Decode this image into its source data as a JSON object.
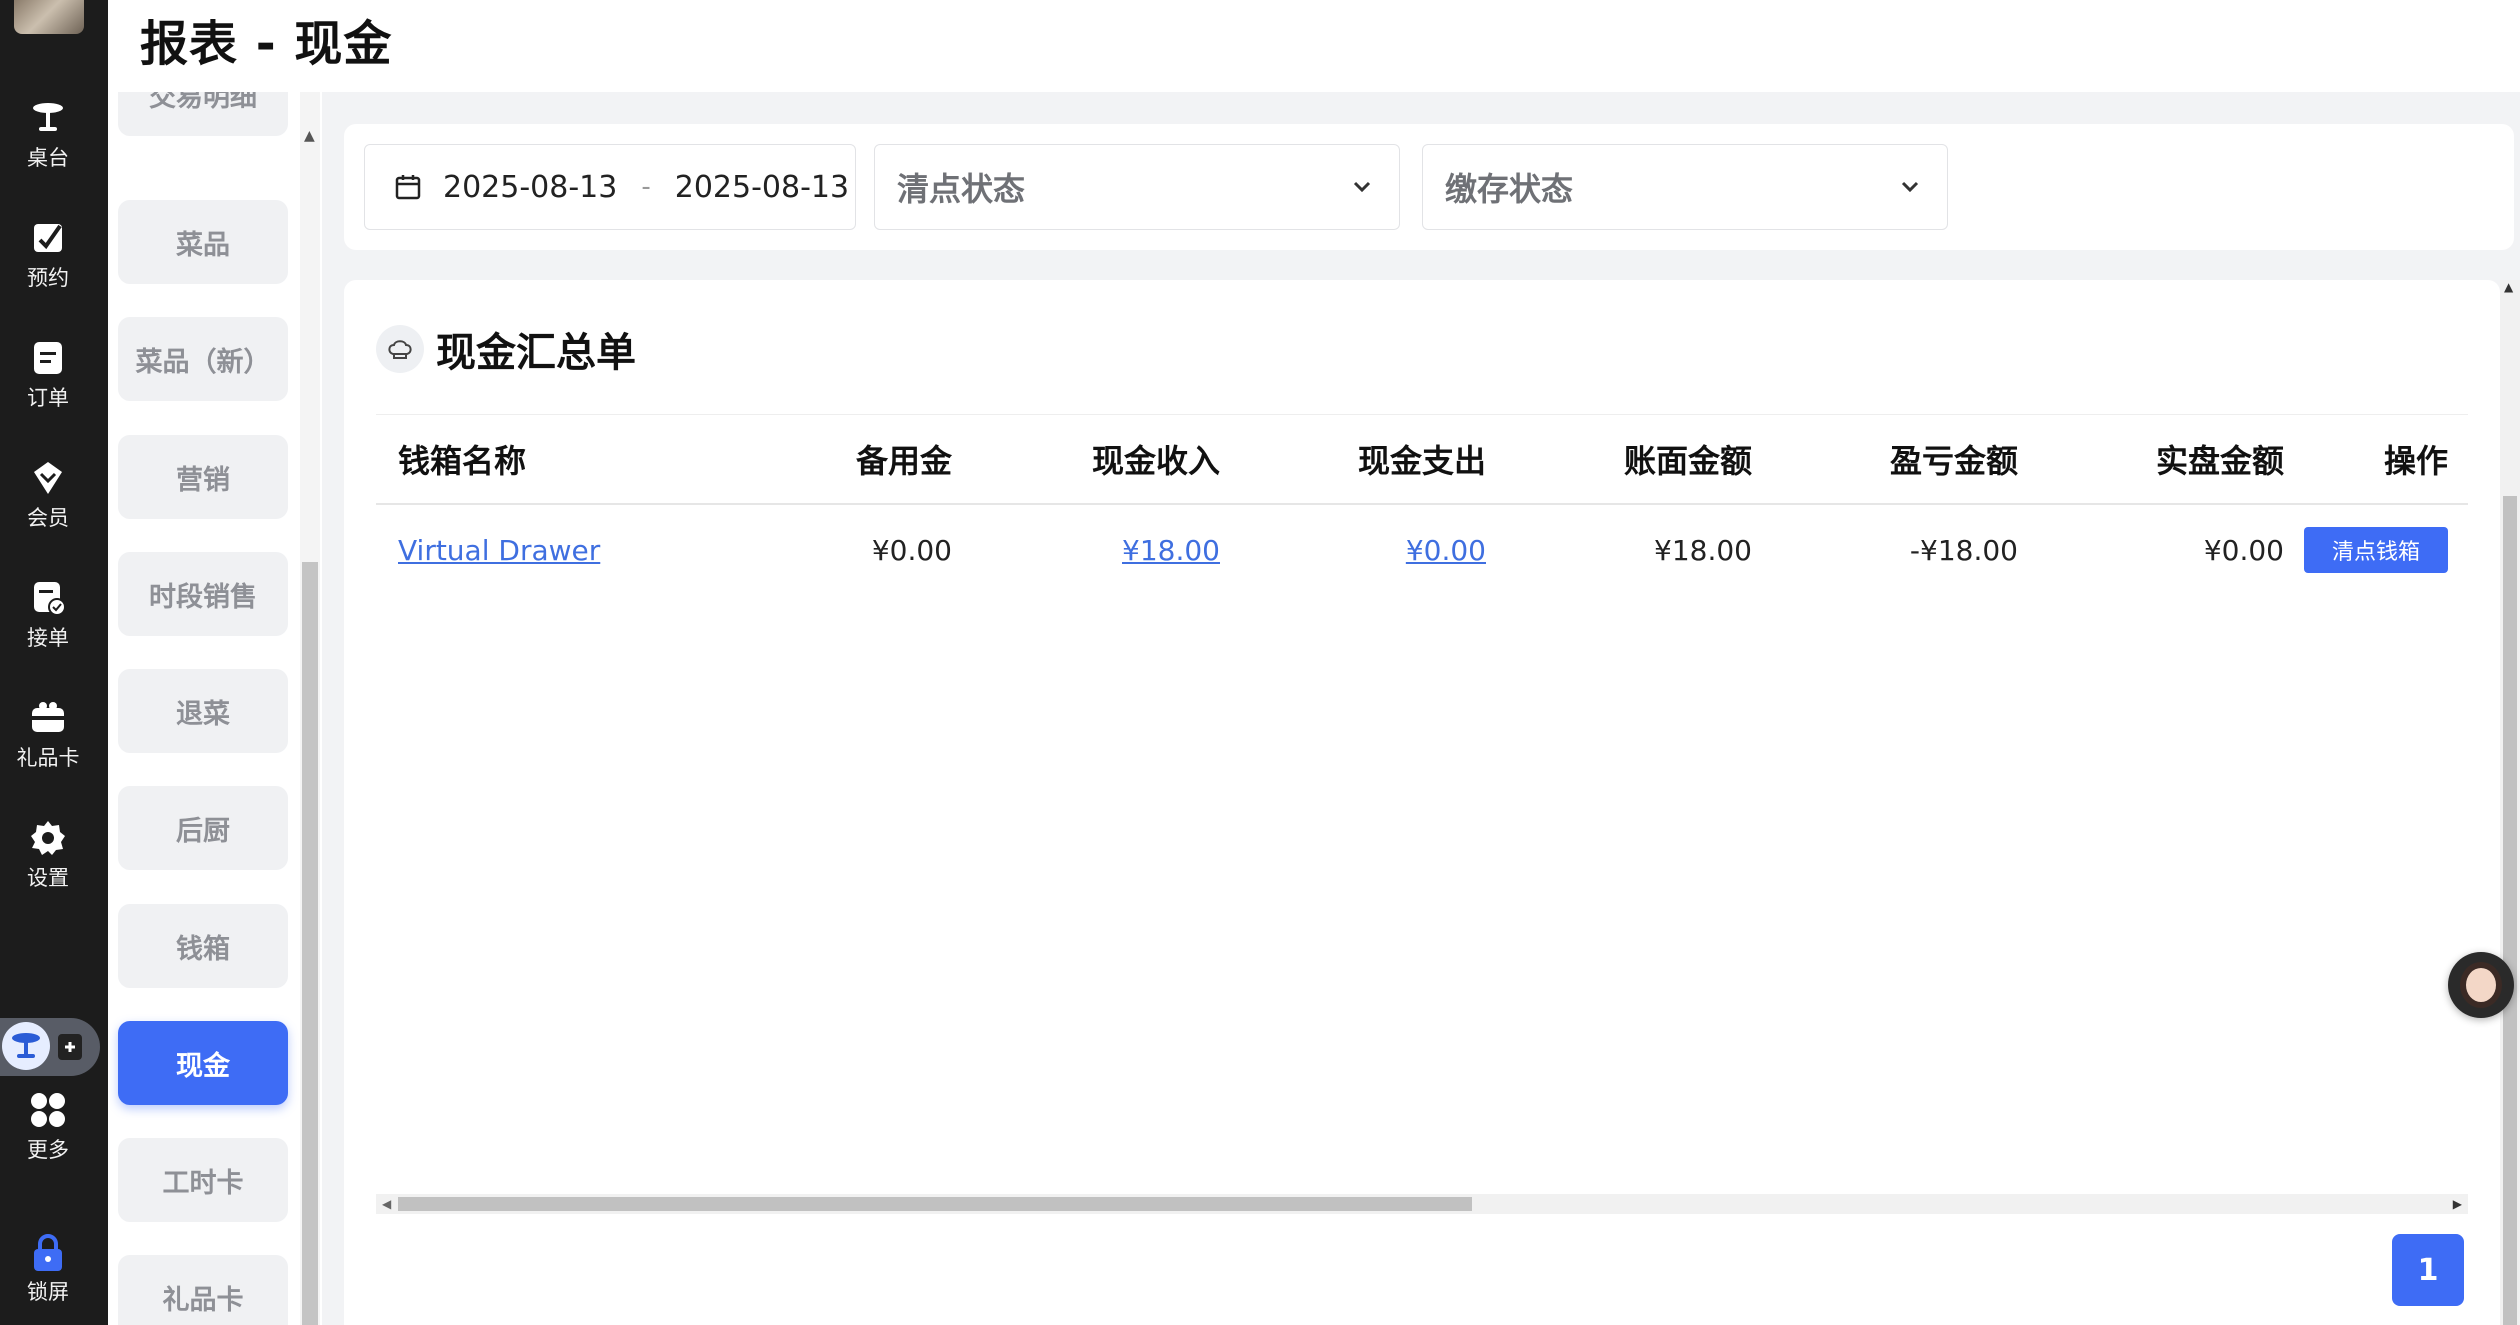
{
  "header": {
    "title": "报表 - 现金"
  },
  "rail": {
    "items": [
      {
        "label": "桌台",
        "icon": "table-icon"
      },
      {
        "label": "预约",
        "icon": "reservation-icon"
      },
      {
        "label": "订单",
        "icon": "order-icon"
      },
      {
        "label": "会员",
        "icon": "member-icon"
      },
      {
        "label": "接单",
        "icon": "accept-order-icon"
      },
      {
        "label": "礼品卡",
        "icon": "gift-card-icon"
      },
      {
        "label": "设置",
        "icon": "settings-icon"
      },
      {
        "label": "更多",
        "icon": "more-icon"
      },
      {
        "label": "锁屏",
        "icon": "lock-icon"
      }
    ]
  },
  "subnav": {
    "items": [
      "交易明细",
      "菜品",
      "菜品（新）",
      "营销",
      "时段销售",
      "退菜",
      "后厨",
      "钱箱",
      "现金",
      "工时卡",
      "礼品卡"
    ],
    "active": "现金"
  },
  "filters": {
    "date_start": "2025-08-13",
    "date_sep": "-",
    "date_end": "2025-08-13",
    "count_status_placeholder": "清点状态",
    "deposit_status_placeholder": "缴存状态"
  },
  "card": {
    "title": "现金汇总单",
    "columns": [
      "钱箱名称",
      "备用金",
      "现金收入",
      "现金支出",
      "账面金额",
      "盈亏金额",
      "实盘金额",
      "操作"
    ],
    "rows": [
      {
        "name": "Virtual Drawer",
        "float": "¥0.00",
        "cash_in": "¥18.00",
        "cash_out": "¥0.00",
        "book": "¥18.00",
        "diff": "-¥18.00",
        "actual": "¥0.00",
        "action": "清点钱箱"
      }
    ]
  },
  "pagination": {
    "current": "1"
  }
}
